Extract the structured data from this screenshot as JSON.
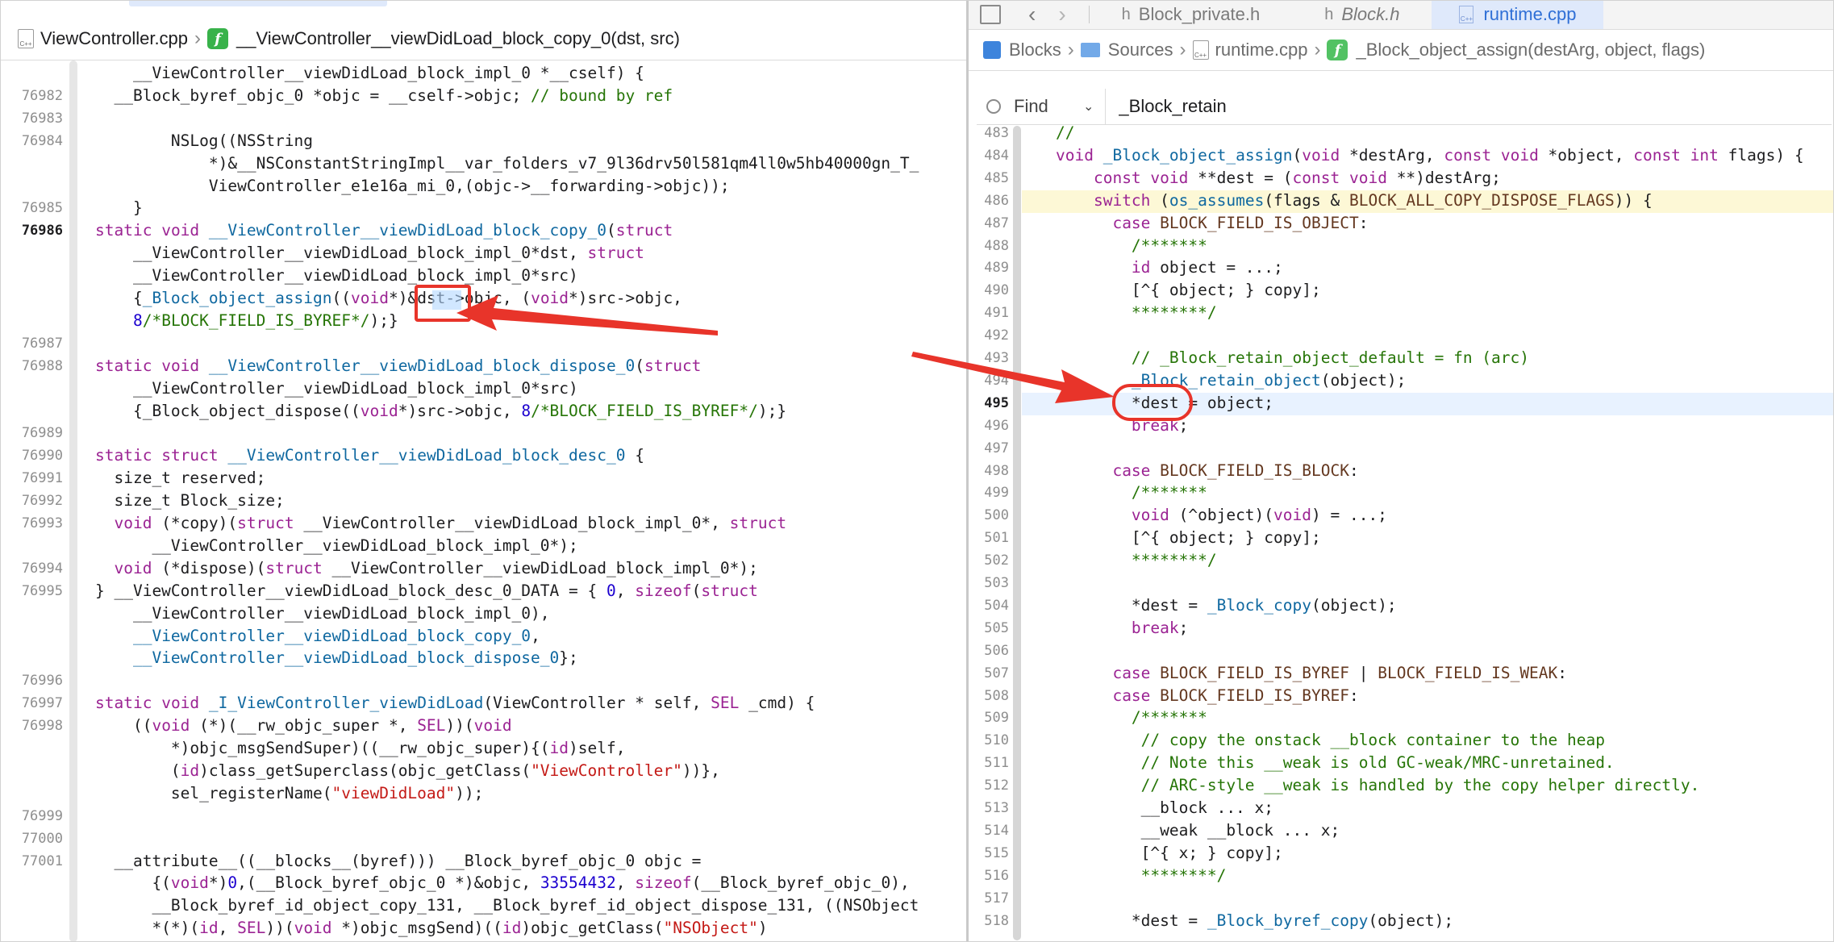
{
  "left": {
    "tab_stub": "",
    "jumpbar": {
      "file_icon_text": "C++",
      "file": "ViewController.cpp",
      "func_icon_text": "f",
      "func": "__ViewController__viewDidLoad_block_copy_0(dst, src)"
    },
    "lines": [
      {
        "n": "",
        "t": "    __ViewController__viewDidLoad_block_impl_0 *__cself) {"
      },
      {
        "n": "76982",
        "t": "  __Block_byref_objc_0 *objc = __cself->objc; // bound by ref"
      },
      {
        "n": "76983",
        "t": ""
      },
      {
        "n": "76984",
        "t": "        NSLog((NSString"
      },
      {
        "n": "",
        "t": "            *)&__NSConstantStringImpl__var_folders_v7_9l36drv50l581qm4ll0w5hb40000gn_T_"
      },
      {
        "n": "",
        "t": "            ViewController_e1e16a_mi_0,(objc->__forwarding->objc));"
      },
      {
        "n": "76985",
        "t": "    }"
      },
      {
        "n": "76986",
        "t": "static void __ViewController__viewDidLoad_block_copy_0(struct"
      },
      {
        "n": "",
        "t": "    __ViewController__viewDidLoad_block_impl_0*dst, struct"
      },
      {
        "n": "",
        "t": "    __ViewController__viewDidLoad_block_impl_0*src)"
      },
      {
        "n": "",
        "t": "    {_Block_object_assign((void*)&dst->objc, (void*)src->objc,"
      },
      {
        "n": "",
        "t": "    8/*BLOCK_FIELD_IS_BYREF*/);}"
      },
      {
        "n": "76987",
        "t": ""
      },
      {
        "n": "76988",
        "t": "static void __ViewController__viewDidLoad_block_dispose_0(struct"
      },
      {
        "n": "",
        "t": "    __ViewController__viewDidLoad_block_impl_0*src)"
      },
      {
        "n": "",
        "t": "    {_Block_object_dispose((void*)src->objc, 8/*BLOCK_FIELD_IS_BYREF*/);}"
      },
      {
        "n": "76989",
        "t": ""
      },
      {
        "n": "76990",
        "t": "static struct __ViewController__viewDidLoad_block_desc_0 {"
      },
      {
        "n": "76991",
        "t": "  size_t reserved;"
      },
      {
        "n": "76992",
        "t": "  size_t Block_size;"
      },
      {
        "n": "76993",
        "t": "  void (*copy)(struct __ViewController__viewDidLoad_block_impl_0*, struct"
      },
      {
        "n": "",
        "t": "      __ViewController__viewDidLoad_block_impl_0*);"
      },
      {
        "n": "76994",
        "t": "  void (*dispose)(struct __ViewController__viewDidLoad_block_impl_0*);"
      },
      {
        "n": "76995",
        "t": "} __ViewController__viewDidLoad_block_desc_0_DATA = { 0, sizeof(struct"
      },
      {
        "n": "",
        "t": "    __ViewController__viewDidLoad_block_impl_0),"
      },
      {
        "n": "",
        "t": "    __ViewController__viewDidLoad_block_copy_0,"
      },
      {
        "n": "",
        "t": "    __ViewController__viewDidLoad_block_dispose_0};"
      },
      {
        "n": "76996",
        "t": ""
      },
      {
        "n": "76997",
        "t": "static void _I_ViewController_viewDidLoad(ViewController * self, SEL _cmd) {"
      },
      {
        "n": "76998",
        "t": "    ((void (*)(__rw_objc_super *, SEL))(void"
      },
      {
        "n": "",
        "t": "        *)objc_msgSendSuper)((__rw_objc_super){(id)self,"
      },
      {
        "n": "",
        "t": "        (id)class_getSuperclass(objc_getClass(\"ViewController\"))},"
      },
      {
        "n": "",
        "t": "        sel_registerName(\"viewDidLoad\"));"
      },
      {
        "n": "76999",
        "t": ""
      },
      {
        "n": "77000",
        "t": ""
      },
      {
        "n": "77001",
        "t": "  __attribute__((__blocks__(byref))) __Block_byref_objc_0 objc ="
      },
      {
        "n": "",
        "t": "      {(void*)0,(__Block_byref_objc_0 *)&objc, 33554432, sizeof(__Block_byref_objc_0),"
      },
      {
        "n": "",
        "t": "      __Block_byref_id_object_copy_131, __Block_byref_id_object_dispose_131, ((NSObject"
      },
      {
        "n": "",
        "t": "      *(*)(id, SEL))(void *)objc_msgSend)((id)objc_getClass(\"NSObject\")"
      }
    ]
  },
  "right": {
    "tabs": [
      {
        "icon": "h",
        "label": "Block_private.h"
      },
      {
        "icon": "h",
        "label": "Block.h"
      },
      {
        "icon": "C++",
        "label": "runtime.cpp"
      }
    ],
    "breadcrumb": {
      "project": "Blocks",
      "folder": "Sources",
      "file": "runtime.cpp",
      "func": "_Block_object_assign(destArg, object, flags)"
    },
    "find": {
      "mode": "Find",
      "query": "_Block_retain"
    },
    "lines": [
      {
        "n": "483",
        "t": "//"
      },
      {
        "n": "484",
        "t": "void _Block_object_assign(void *destArg, const void *object, const int flags) {"
      },
      {
        "n": "485",
        "t": "    const void **dest = (const void **)destArg;"
      },
      {
        "n": "486",
        "t": "    switch (os_assumes(flags & BLOCK_ALL_COPY_DISPOSE_FLAGS)) {"
      },
      {
        "n": "487",
        "t": "      case BLOCK_FIELD_IS_OBJECT:"
      },
      {
        "n": "488",
        "t": "        /*******"
      },
      {
        "n": "489",
        "t": "        id object = ...;"
      },
      {
        "n": "490",
        "t": "        [^{ object; } copy];"
      },
      {
        "n": "491",
        "t": "        ********/"
      },
      {
        "n": "492",
        "t": ""
      },
      {
        "n": "493",
        "t": "        // _Block_retain_object_default = fn (arc)"
      },
      {
        "n": "494",
        "t": "        _Block_retain_object(object);"
      },
      {
        "n": "495",
        "t": "        *dest = object;"
      },
      {
        "n": "496",
        "t": "        break;"
      },
      {
        "n": "497",
        "t": ""
      },
      {
        "n": "498",
        "t": "      case BLOCK_FIELD_IS_BLOCK:"
      },
      {
        "n": "499",
        "t": "        /*******"
      },
      {
        "n": "500",
        "t": "        void (^object)(void) = ...;"
      },
      {
        "n": "501",
        "t": "        [^{ object; } copy];"
      },
      {
        "n": "502",
        "t": "        ********/"
      },
      {
        "n": "503",
        "t": ""
      },
      {
        "n": "504",
        "t": "        *dest = _Block_copy(object);"
      },
      {
        "n": "505",
        "t": "        break;"
      },
      {
        "n": "506",
        "t": ""
      },
      {
        "n": "507",
        "t": "      case BLOCK_FIELD_IS_BYREF | BLOCK_FIELD_IS_WEAK:"
      },
      {
        "n": "508",
        "t": "      case BLOCK_FIELD_IS_BYREF:"
      },
      {
        "n": "509",
        "t": "        /*******"
      },
      {
        "n": "510",
        "t": "         // copy the onstack __block container to the heap"
      },
      {
        "n": "511",
        "t": "         // Note this __weak is old GC-weak/MRC-unretained."
      },
      {
        "n": "512",
        "t": "         // ARC-style __weak is handled by the copy helper directly."
      },
      {
        "n": "513",
        "t": "         __block ... x;"
      },
      {
        "n": "514",
        "t": "         __weak __block ... x;"
      },
      {
        "n": "515",
        "t": "         [^{ x; } copy];"
      },
      {
        "n": "516",
        "t": "         ********/"
      },
      {
        "n": "517",
        "t": ""
      },
      {
        "n": "518",
        "t": "        *dest = _Block_byref_copy(object);"
      }
    ]
  },
  "colors": {
    "annotation": "#e8342a",
    "keyword": "#9b2393",
    "comment": "#267507",
    "string": "#c41a16",
    "number": "#1c00cf",
    "current_line": "#e8f2ff",
    "find_highlight": "#fdf8d6"
  },
  "icons": [
    "file-cpp-icon",
    "function-icon",
    "grid-icon",
    "chevron-left-icon",
    "chevron-right-icon",
    "header-file-icon",
    "project-icon",
    "folder-icon",
    "magnifier-icon",
    "chevron-down-icon"
  ]
}
